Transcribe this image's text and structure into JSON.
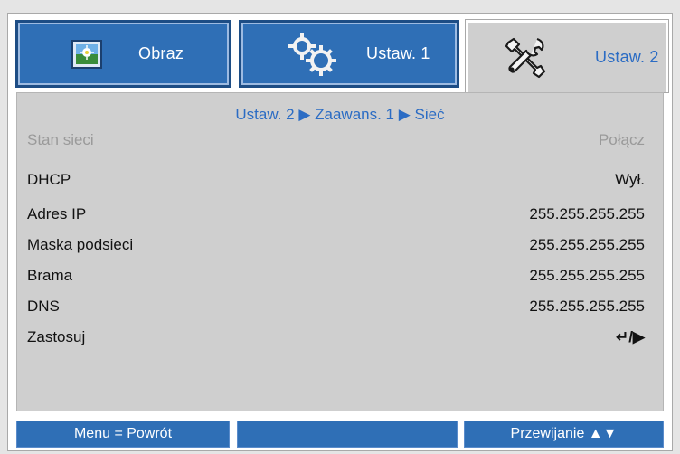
{
  "tabs": [
    {
      "label": "Obraz",
      "icon": "image-icon",
      "active": false
    },
    {
      "label": "Ustaw. 1",
      "icon": "gears-icon",
      "active": false
    },
    {
      "label": "Ustaw. 2",
      "icon": "tools-icon",
      "active": true
    }
  ],
  "breadcrumb": "Ustaw. 2 ▶ Zaawans. 1 ▶ Sieć",
  "rows": [
    {
      "label": "Stan sieci",
      "value": "Połącz",
      "disabled": true
    },
    {
      "label": "DHCP",
      "value": "Wył.",
      "disabled": false
    },
    {
      "label": "Adres IP",
      "value": "255.255.255.255",
      "disabled": false
    },
    {
      "label": "Maska podsieci",
      "value": "255.255.255.255",
      "disabled": false
    },
    {
      "label": "Brama",
      "value": "255.255.255.255",
      "disabled": false
    },
    {
      "label": "DNS",
      "value": "255.255.255.255",
      "disabled": false
    },
    {
      "label": "Zastosuj",
      "value": "↵/▶",
      "disabled": false
    }
  ],
  "footer": {
    "left": "Menu = Powrót",
    "middle": "",
    "right": "Przewijanie ▲▼"
  },
  "colors": {
    "tab_blue": "#2f6fb6",
    "active_text": "#2b6cc4",
    "panel_gray": "#cfcfcf"
  }
}
